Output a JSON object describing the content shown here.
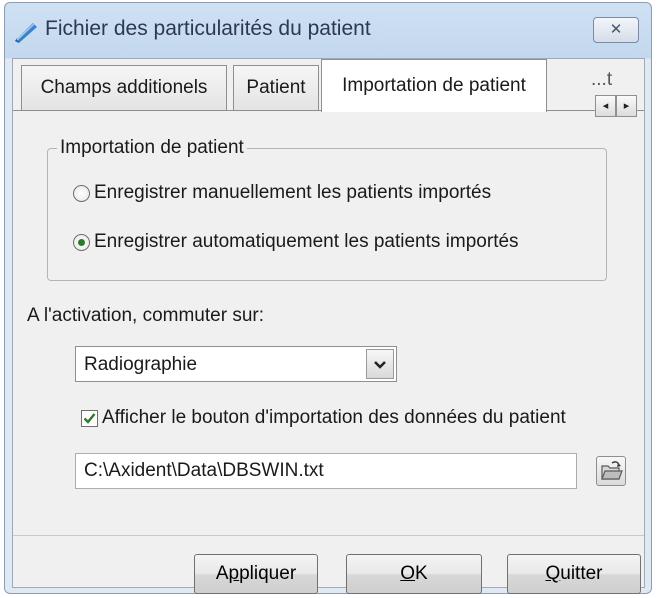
{
  "window": {
    "title": "Fichier des particularités du patient",
    "close_symbol": "✕"
  },
  "tabs": [
    {
      "label": "Champs additionels",
      "active": false
    },
    {
      "label": "Patient",
      "active": false
    },
    {
      "label": "Importation de patient",
      "active": true
    }
  ],
  "tab_partial": "...ti",
  "tab_scroll": {
    "left": "◂",
    "right": "▸"
  },
  "import_group": {
    "title": "Importation de patient",
    "options": [
      {
        "label": "Enregistrer manuellement les patients importés",
        "selected": false
      },
      {
        "label": "Enregistrer automatiquement les patients importés",
        "selected": true
      }
    ]
  },
  "activation": {
    "label": "A l'activation, commuter sur:",
    "selected_value": "Radiographie",
    "dropdown_icon": "chevron-down-icon"
  },
  "show_import_button": {
    "label": "Afficher le bouton d'importation des données du patient",
    "checked": true
  },
  "path": {
    "value": "C:\\Axident\\Data\\DBSWIN.txt",
    "browse_icon": "folder-browse-icon"
  },
  "buttons": {
    "apply": {
      "pre": "A",
      "u": "p",
      "post": "pliquer"
    },
    "ok": {
      "pre": "",
      "u": "O",
      "post": "K"
    },
    "quit": {
      "pre": "",
      "u": "Q",
      "post": "uitter"
    }
  },
  "colors": {
    "title_gradient_top": "#cfe0f3",
    "client_bg": "#f0f0f0",
    "radio_dot": "#2b7a2b",
    "check_mark": "#2b7a2b"
  }
}
